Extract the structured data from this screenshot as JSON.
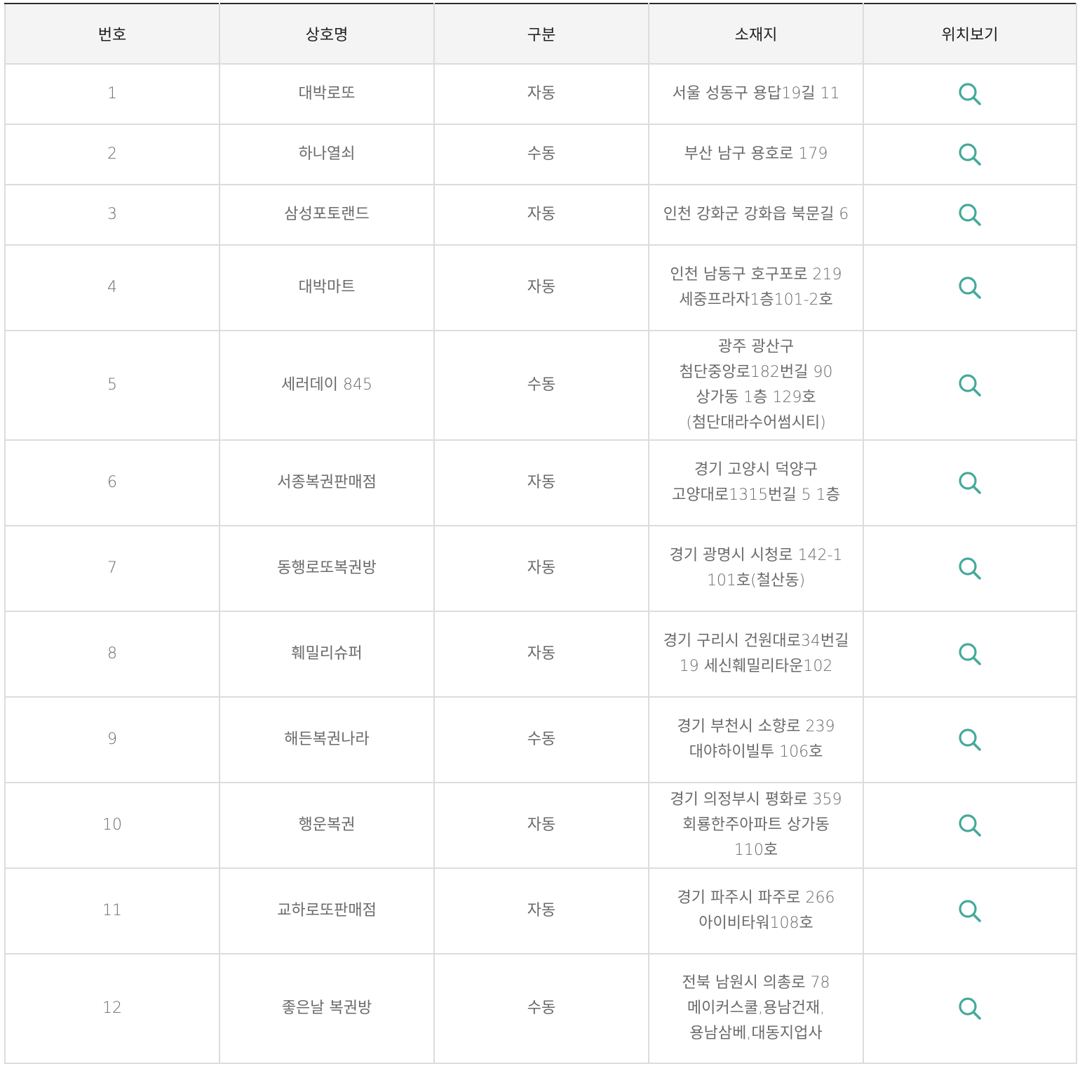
{
  "colors": {
    "header_bg": "#f4f4f4",
    "border": "#dcdcdc",
    "header_top_border": "#2b2b2b",
    "text": "#6a6a6a",
    "icon": "#45a99b"
  },
  "table": {
    "headers": [
      "번호",
      "상호명",
      "구분",
      "소재지",
      "위치보기"
    ],
    "rows": [
      {
        "no": "1",
        "name": "대박로또",
        "type": "자동",
        "address": "서울 성동구 용답19길 11",
        "icon": "search-icon"
      },
      {
        "no": "2",
        "name": "하나열쇠",
        "type": "수동",
        "address": "부산 남구 용호로 179",
        "icon": "search-icon"
      },
      {
        "no": "3",
        "name": "삼성포토랜드",
        "type": "자동",
        "address": "인천 강화군 강화읍 북문길 6",
        "icon": "search-icon"
      },
      {
        "no": "4",
        "name": "대박마트",
        "type": "자동",
        "address": "인천 남동구 호구포로 219 세중프라자1층101-2호",
        "icon": "search-icon"
      },
      {
        "no": "5",
        "name": "세러데이 845",
        "type": "수동",
        "address": "광주 광산구 첨단중앙로182번길 90 상가동 1층 129호(첨단대라수어썸시티)",
        "icon": "search-icon"
      },
      {
        "no": "6",
        "name": "서종복권판매점",
        "type": "자동",
        "address": "경기 고양시 덕양구 고양대로1315번길 5 1층",
        "icon": "search-icon"
      },
      {
        "no": "7",
        "name": "동행로또복권방",
        "type": "자동",
        "address": "경기 광명시 시청로 142-1 101호(철산동)",
        "icon": "search-icon"
      },
      {
        "no": "8",
        "name": "훼밀리슈퍼",
        "type": "자동",
        "address": "경기 구리시 건원대로34번길 19 세신훼밀리타운102",
        "icon": "search-icon"
      },
      {
        "no": "9",
        "name": "해든복권나라",
        "type": "수동",
        "address": "경기 부천시 소향로 239 대야하이빌투 106호",
        "icon": "search-icon"
      },
      {
        "no": "10",
        "name": "행운복권",
        "type": "자동",
        "address": "경기 의정부시 평화로 359 회룡한주아파트 상가동 110호",
        "icon": "search-icon"
      },
      {
        "no": "11",
        "name": "교하로또판매점",
        "type": "자동",
        "address": "경기 파주시 파주로 266 아이비타워108호",
        "icon": "search-icon"
      },
      {
        "no": "12",
        "name": "좋은날 복권방",
        "type": "수동",
        "address": "전북 남원시 의총로 78 메이커스쿨,용남건재,용남삼베,대동지업사",
        "icon": "search-icon"
      }
    ]
  }
}
